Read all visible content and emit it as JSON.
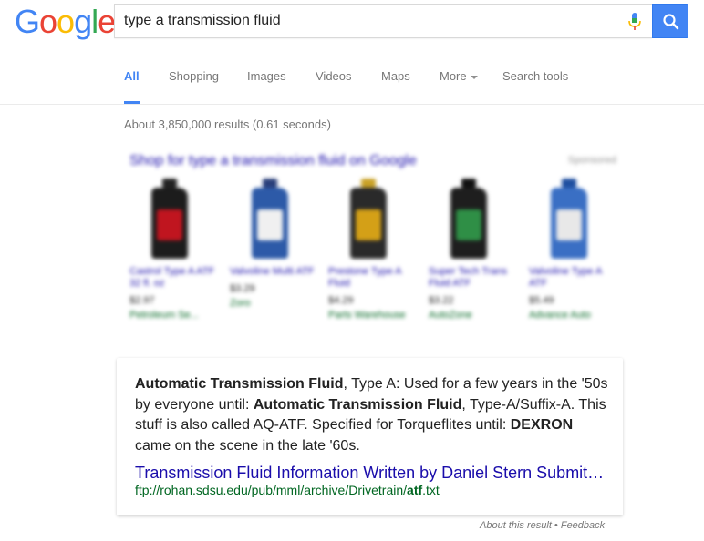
{
  "logo": {
    "letters": [
      {
        "char": "G",
        "color": "#4285f4"
      },
      {
        "char": "o",
        "color": "#ea4335"
      },
      {
        "char": "o",
        "color": "#fbbc05"
      },
      {
        "char": "g",
        "color": "#4285f4"
      },
      {
        "char": "l",
        "color": "#34a853"
      },
      {
        "char": "e",
        "color": "#ea4335"
      }
    ]
  },
  "search": {
    "query": "type a transmission fluid",
    "button_icon": "search-icon",
    "mic_icon": "microphone-icon"
  },
  "tabs": {
    "all": "All",
    "shopping": "Shopping",
    "images": "Images",
    "videos": "Videos",
    "maps": "Maps",
    "more": "More",
    "search_tools": "Search tools"
  },
  "stats": "About 3,850,000 results (0.61 seconds)",
  "shopping": {
    "title": "Shop for type a transmission fluid on Google",
    "sponsored": "Sponsored",
    "products": [
      {
        "cap": "#222",
        "body": "#1c1c1c",
        "label": "#c0151f",
        "name": "Castrol Type A ATF 32 fl. oz",
        "price": "$2.97",
        "store": "Petroleum Se..."
      },
      {
        "cap": "#2a3f7a",
        "body": "#2d5aa8",
        "label": "#f0f0f0",
        "name": "Valvoline Multi ATF",
        "price": "$3.29",
        "store": "Zoro"
      },
      {
        "cap": "#c9a227",
        "body": "#2a2a2a",
        "label": "#d4a017",
        "name": "Prestone Type A Fluid",
        "price": "$4.29",
        "store": "Parts Warehouse"
      },
      {
        "cap": "#111",
        "body": "#1e1e1e",
        "label": "#2f8f46",
        "name": "Super Tech Trans Fluid ATF",
        "price": "$3.22",
        "store": "AutoZone"
      },
      {
        "cap": "#1f4fa0",
        "body": "#3a6fc4",
        "label": "#e8e8e8",
        "name": "Valvoline Type A ATF",
        "price": "$5.49",
        "store": "Advance Auto"
      }
    ]
  },
  "snippet": {
    "text": [
      {
        "t": "Automatic Transmission Fluid",
        "bold": true
      },
      {
        "t": ", Type A: Used for a few years in the '50s by everyone until: ",
        "bold": false
      },
      {
        "t": "Automatic Transmission Fluid",
        "bold": true
      },
      {
        "t": ", Type-A/Suffix-A. This stuff is also called AQ-ATF. Specified for Torqueflites until: ",
        "bold": false
      },
      {
        "t": "DEXRON",
        "bold": true
      },
      {
        "t": " came on the scene in the late '60s.",
        "bold": false
      }
    ],
    "result_title": "Transmission Fluid Information Written by Daniel Stern Submit…",
    "result_url_prefix": "ftp://rohan.sdsu.edu/pub/mml/archive/Drivetrain/",
    "result_url_bold": "atf",
    "result_url_suffix": ".txt"
  },
  "footer": {
    "about": "About this result",
    "separator": " • ",
    "feedback": "Feedback"
  }
}
